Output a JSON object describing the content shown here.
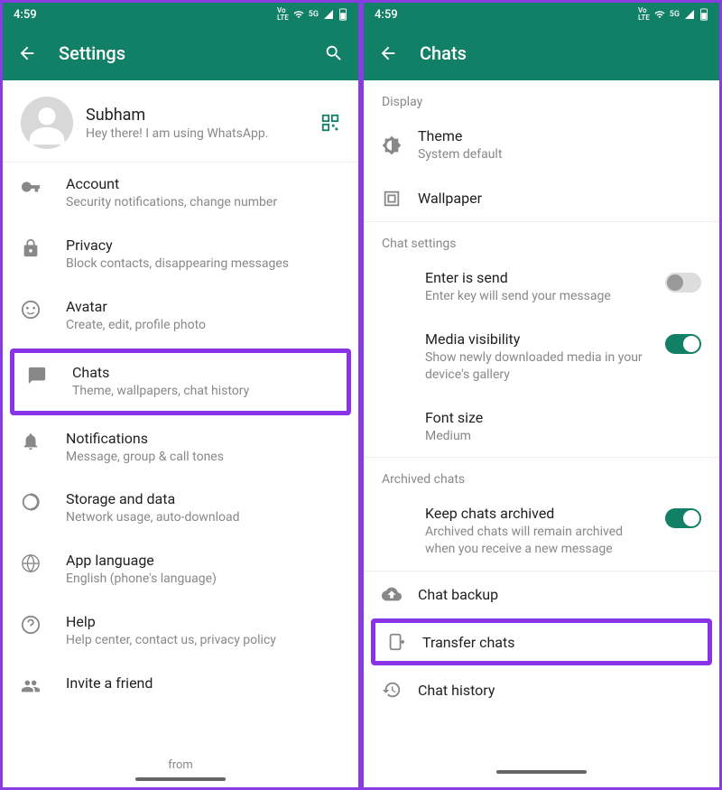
{
  "status": {
    "time": "4:59",
    "indicators": "VoLTE 5G"
  },
  "left": {
    "header": {
      "title": "Settings"
    },
    "profile": {
      "name": "Subham",
      "status": "Hey there! I am using WhatsApp."
    },
    "items": [
      {
        "title": "Account",
        "sub": "Security notifications, change number"
      },
      {
        "title": "Privacy",
        "sub": "Block contacts, disappearing messages"
      },
      {
        "title": "Avatar",
        "sub": "Create, edit, profile photo"
      },
      {
        "title": "Chats",
        "sub": "Theme, wallpapers, chat history"
      },
      {
        "title": "Notifications",
        "sub": "Message, group & call tones"
      },
      {
        "title": "Storage and data",
        "sub": "Network usage, auto-download"
      },
      {
        "title": "App language",
        "sub": "English (phone's language)"
      },
      {
        "title": "Help",
        "sub": "Help center, contact us, privacy policy"
      },
      {
        "title": "Invite a friend",
        "sub": ""
      }
    ],
    "footer": "from"
  },
  "right": {
    "header": {
      "title": "Chats"
    },
    "sections": {
      "display": {
        "header": "Display",
        "theme": {
          "title": "Theme",
          "sub": "System default"
        },
        "wallpaper": {
          "title": "Wallpaper"
        }
      },
      "chatSettings": {
        "header": "Chat settings",
        "enterSend": {
          "title": "Enter is send",
          "sub": "Enter key will send your message"
        },
        "mediaVis": {
          "title": "Media visibility",
          "sub": "Show newly downloaded media in your device's gallery"
        },
        "fontSize": {
          "title": "Font size",
          "sub": "Medium"
        }
      },
      "archived": {
        "header": "Archived chats",
        "keep": {
          "title": "Keep chats archived",
          "sub": "Archived chats will remain archived when you receive a new message"
        }
      },
      "bottom": {
        "backup": "Chat backup",
        "transfer": "Transfer chats",
        "history": "Chat history"
      }
    }
  }
}
